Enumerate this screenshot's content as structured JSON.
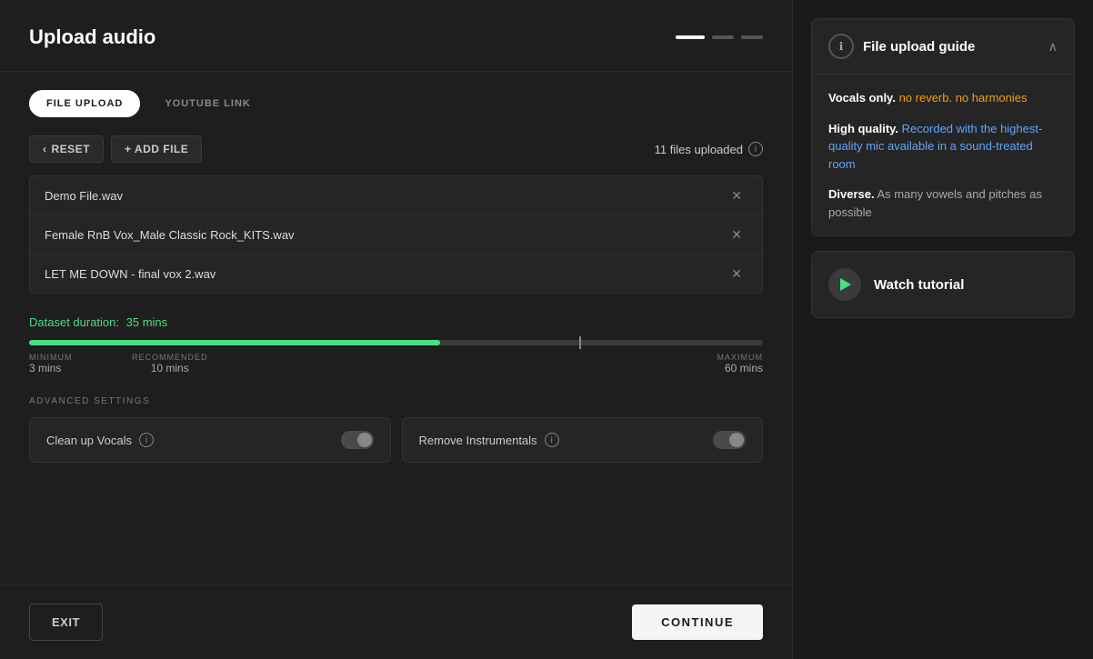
{
  "header": {
    "title": "Upload audio",
    "steps": [
      {
        "type": "active"
      },
      {
        "type": "inactive"
      },
      {
        "type": "inactive"
      }
    ]
  },
  "tabs": [
    {
      "label": "FILE UPLOAD",
      "active": true
    },
    {
      "label": "YOUTUBE LINK",
      "active": false
    }
  ],
  "toolbar": {
    "reset_label": "RESET",
    "add_file_label": "+ ADD FILE",
    "files_count": "11 files uploaded"
  },
  "files": [
    {
      "name": "Demo File.wav"
    },
    {
      "name": "Female RnB Vox_Male Classic Rock_KITS.wav"
    },
    {
      "name": "LET ME DOWN - final vox 2.wav"
    }
  ],
  "duration": {
    "label": "Dataset duration:",
    "value": "35 mins",
    "progress_percent": 56,
    "markers": {
      "minimum": {
        "label": "MINIMUM",
        "value": "3 mins",
        "position": 4
      },
      "recommended": {
        "label": "RECOMMENDED",
        "value": "10 mins",
        "position": 14
      },
      "maximum": {
        "label": "MAXIMUM",
        "value": "60 mins",
        "position": 75
      }
    }
  },
  "advanced_settings": {
    "label": "ADVANCED SETTINGS",
    "settings": [
      {
        "label": "Clean up Vocals",
        "has_info": true,
        "enabled": false
      },
      {
        "label": "Remove Instrumentals",
        "has_info": true,
        "enabled": false
      }
    ]
  },
  "footer": {
    "exit_label": "EXIT",
    "continue_label": "CONTINUE"
  },
  "guide": {
    "icon": "ℹ",
    "title": "File upload guide",
    "items": [
      {
        "highlight": "Vocals only.",
        "highlight_type": "white",
        "rest": " no reverb. no harmonies",
        "rest_type": "orange"
      },
      {
        "highlight": "High quality.",
        "highlight_type": "white",
        "rest": " Recorded with the highest-quality mic available in a sound-treated room",
        "rest_type": "blue"
      },
      {
        "highlight": "Diverse.",
        "highlight_type": "white",
        "rest": " As many vowels and pitches as possible",
        "rest_type": "default"
      }
    ]
  },
  "tutorial": {
    "label": "Watch tutorial"
  }
}
